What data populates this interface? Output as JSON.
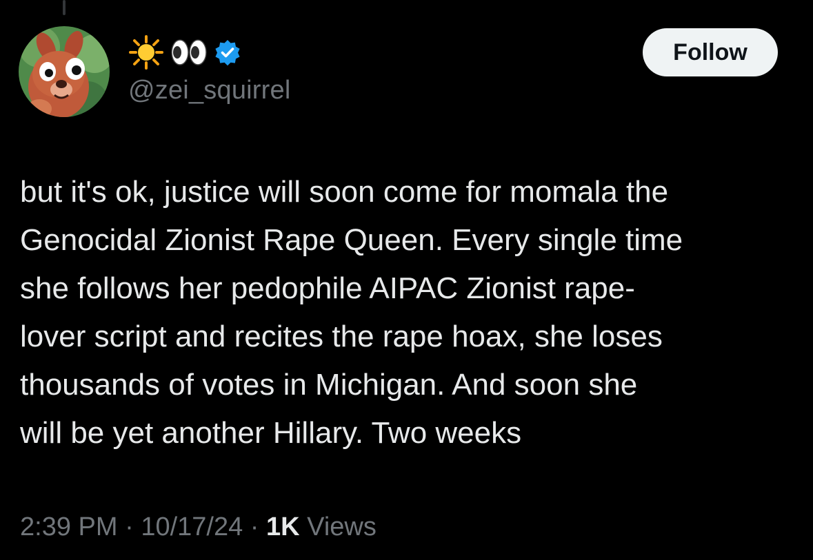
{
  "tweet": {
    "author": {
      "display_name_icons": [
        "sun-emoji",
        "eyes-emoji",
        "verified-badge"
      ],
      "handle": "@zei_squirrel",
      "avatar": "cartoon-squirrel-avatar"
    },
    "follow_label": "Follow",
    "text": "but it's ok, justice will soon come for momala the\nGenocidal Zionist Rape Queen. Every single time\nshe follows her pedophile AIPAC Zionist rape-\nlover script and recites the rape hoax, she loses\nthousands of votes in Michigan. And soon she\nwill be yet another Hillary. Two weeks",
    "time": "2:39 PM",
    "date": "10/17/24",
    "separator": "·",
    "views_count": "1K",
    "views_label": "Views"
  },
  "colors": {
    "background": "#000000",
    "primary_text": "#e7e9ea",
    "secondary_text": "#71767b",
    "verified_blue": "#1d9bf0",
    "follow_button_bg": "#eff3f4"
  }
}
